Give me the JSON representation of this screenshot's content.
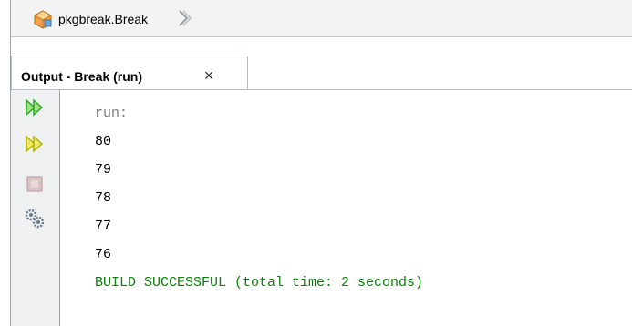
{
  "breadcrumb": {
    "path": "pkgbreak.Break",
    "icon": "class-cube-icon",
    "chevron": "chevron-right-icon"
  },
  "output_panel": {
    "tab_label": "Output - Break (run)",
    "close_glyph": "×",
    "toolbar": [
      {
        "name": "rerun-icon",
        "color": "#2fa82f"
      },
      {
        "name": "rerun-with-options-icon",
        "color": "#b3b300"
      },
      {
        "name": "stop-icon",
        "color": "#c7a8a8"
      },
      {
        "name": "settings-icon",
        "color": "#6b7b8c"
      }
    ],
    "lines": [
      {
        "text": "run:",
        "style": "muted"
      },
      {
        "text": "80",
        "style": "normal"
      },
      {
        "text": "79",
        "style": "normal"
      },
      {
        "text": "78",
        "style": "normal"
      },
      {
        "text": "77",
        "style": "normal"
      },
      {
        "text": "76",
        "style": "normal"
      },
      {
        "text": "BUILD SUCCESSFUL (total time: 2 seconds)",
        "style": "success"
      }
    ]
  },
  "colors": {
    "success_text": "#0b7f0b",
    "muted_text": "#7a7a7a",
    "border": "#9aa3ad"
  }
}
